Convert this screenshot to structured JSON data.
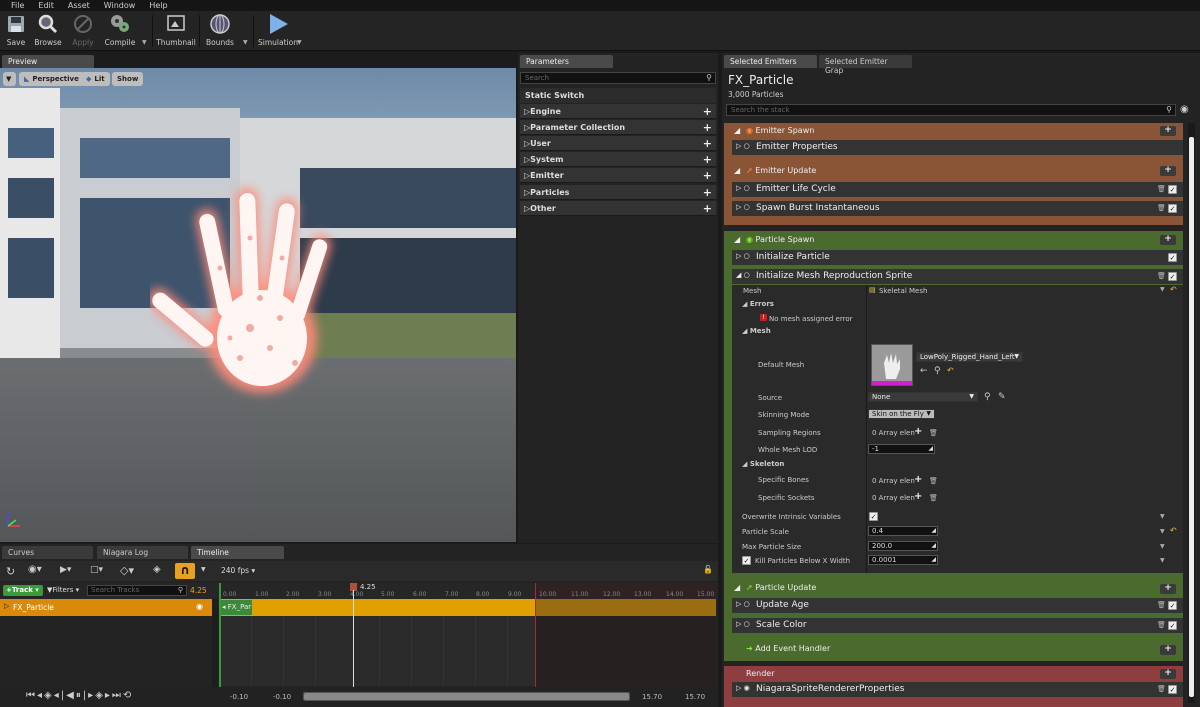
{
  "menu": [
    "File",
    "Edit",
    "Asset",
    "Window",
    "Help"
  ],
  "toolbar": {
    "save": "Save",
    "browse": "Browse",
    "apply": "Apply",
    "compile": "Compile",
    "thumbnail": "Thumbnail",
    "bounds": "Bounds",
    "simulation": "Simulation"
  },
  "preview": {
    "tab": "Preview",
    "perspective": "Perspective",
    "lit": "Lit",
    "show": "Show"
  },
  "parameters": {
    "tab": "Parameters",
    "search_placeholder": "Search",
    "static_switch": "Static Switch",
    "groups": [
      "Engine",
      "Parameter Collection",
      "User",
      "System",
      "Emitter",
      "Particles",
      "Other"
    ]
  },
  "stack": {
    "tabs": [
      "Selected Emitters",
      "Selected Emitter Grap"
    ],
    "emitter_name": "FX_Particle",
    "particle_count": "3,000 Particles",
    "search_placeholder": "Search the stack",
    "emitter_spawn": "Emitter Spawn",
    "emitter_properties": "Emitter Properties",
    "emitter_update": "Emitter Update",
    "emitter_life_cycle": "Emitter Life Cycle",
    "spawn_burst": "Spawn Burst Instantaneous",
    "particle_spawn": "Particle Spawn",
    "initialize_particle": "Initialize Particle",
    "init_mesh_repro": "Initialize Mesh Reproduction Sprite",
    "mesh_label": "Mesh",
    "mesh_value": "Skeletal Mesh",
    "errors": "Errors",
    "error_msg": "No mesh assigned error",
    "mesh_group": "Mesh",
    "default_mesh": "Default Mesh",
    "default_mesh_value": "LowPoly_Rigged_Hand_Left",
    "source": "Source",
    "source_value": "None",
    "skinning_mode": "Skinning Mode",
    "skinning_value": "Skin on the Fly",
    "sampling_regions": "Sampling Regions",
    "sampling_value": "0 Array elen",
    "whole_mesh_lod": "Whole Mesh LOD",
    "lod_value": "-1",
    "skeleton": "Skeleton",
    "specific_bones": "Specific Bones",
    "bones_value": "0 Array elen",
    "specific_sockets": "Specific Sockets",
    "sockets_value": "0 Array elen",
    "overwrite_intrinsic": "Overwrite Intrinsic Variables",
    "particle_scale": "Particle Scale",
    "particle_scale_value": "0.4",
    "max_particle_size": "Max Particle Size",
    "max_size_value": "200.0",
    "kill_particles": "Kill Particles Below X Width",
    "kill_value": "0.0001",
    "particle_update": "Particle Update",
    "update_age": "Update Age",
    "scale_color": "Scale Color",
    "add_event_handler": "Add Event Handler",
    "render": "Render",
    "sprite_renderer": "NiagaraSpriteRendererProperties"
  },
  "bottom": {
    "tabs": [
      "Curves",
      "Niagara Log",
      "Timeline"
    ],
    "fps": "240 fps",
    "track_btn": "Track",
    "filters": "Filters",
    "search_tracks": "Search Tracks",
    "current_time": "4.25",
    "track_name": "FX_Particle",
    "clip_name": "FX_Par",
    "ticks": [
      "0.00",
      "1.00",
      "2.00",
      "3.00",
      "4.00",
      "5.00",
      "6.00",
      "7.00",
      "8.00",
      "9.00",
      "10.00",
      "11.00",
      "12.00",
      "13.00",
      "14.00",
      "15.00"
    ],
    "range_start_a": "-0.10",
    "range_start_b": "-0.10",
    "range_end_a": "15.70",
    "range_end_b": "15.70"
  },
  "colors": {
    "emitter_section": "#8a5536",
    "particle_section": "#4b6a2e",
    "render_section": "#8e3e3e",
    "track_orange": "#d98a0a",
    "timeline_clip": "#e0a000"
  }
}
